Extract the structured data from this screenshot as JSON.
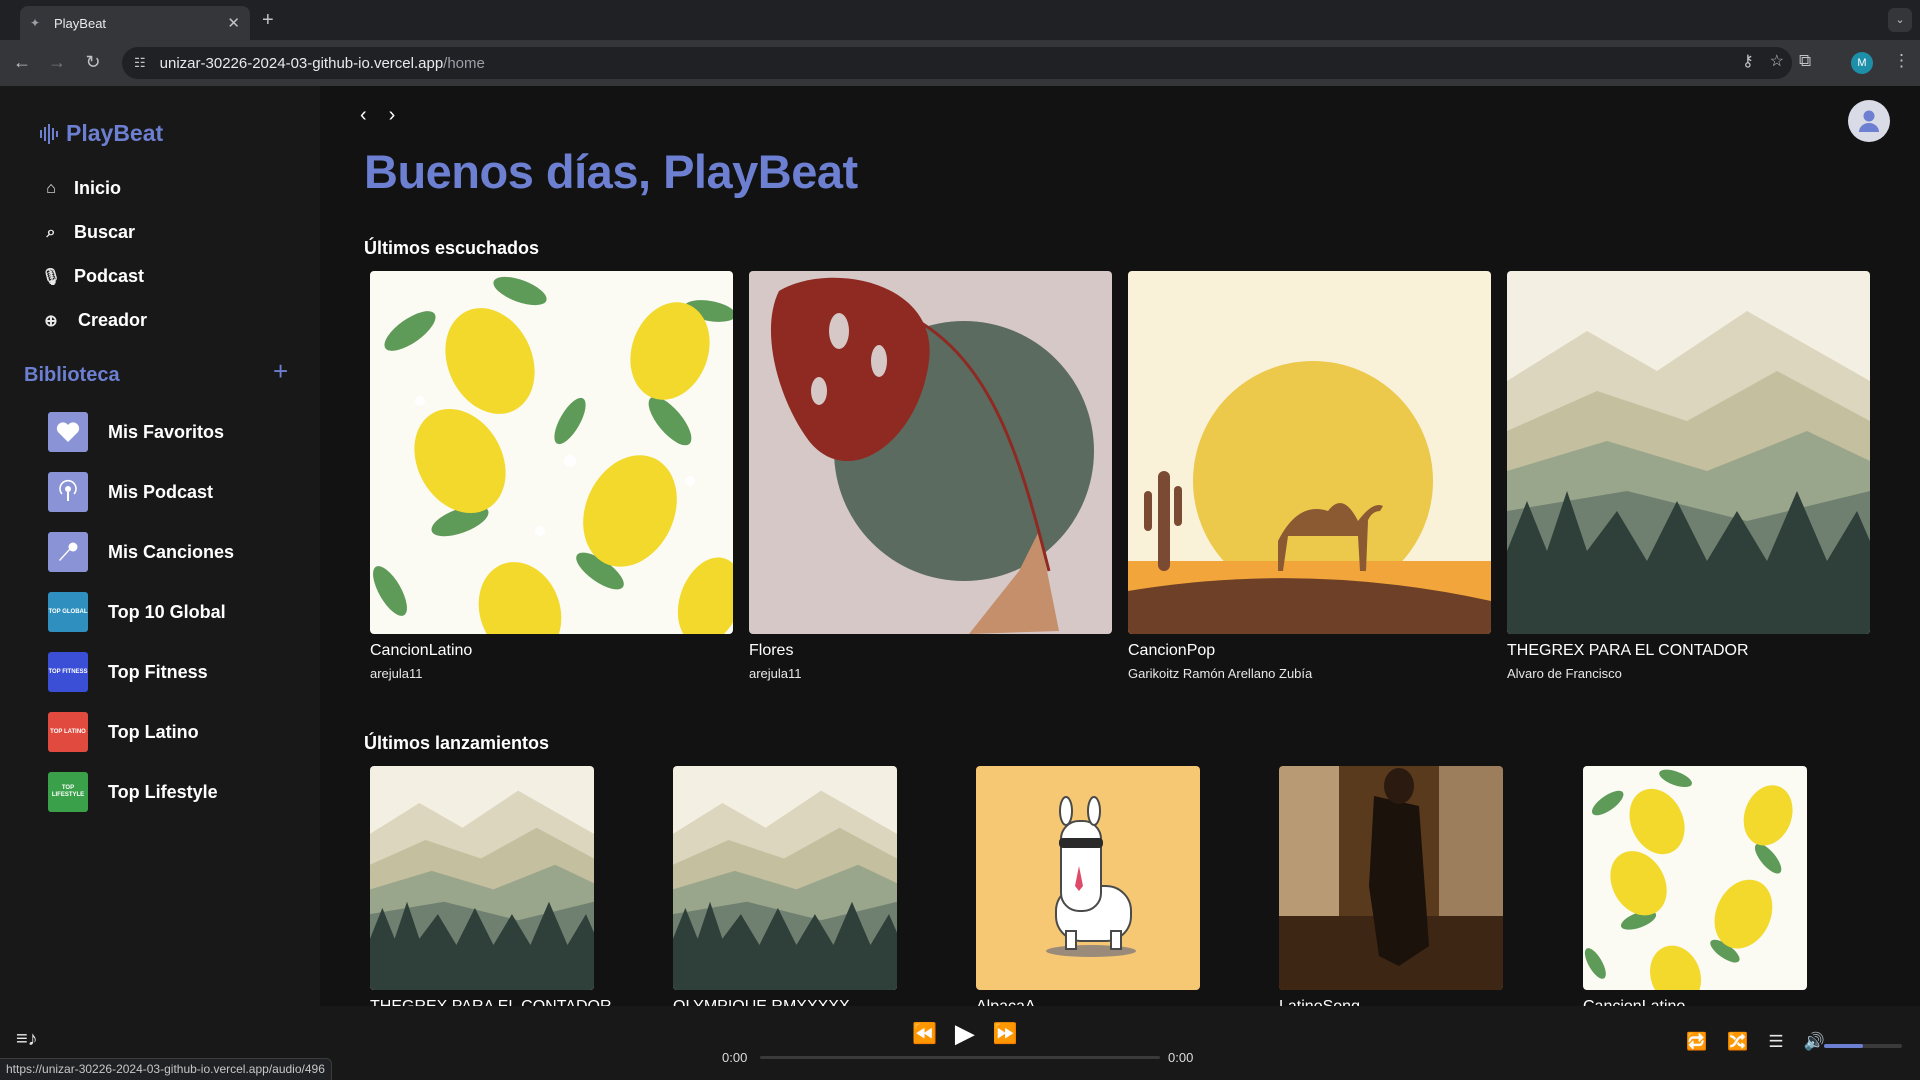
{
  "browser": {
    "tab_title": "PlayBeat",
    "url_host": "unizar-30226-2024-03-github-io.vercel.app",
    "url_path": "/home",
    "profile_initial": "M",
    "status_url": "https://unizar-30226-2024-03-github-io.vercel.app/audio/496"
  },
  "sidebar": {
    "brand": "PlayBeat",
    "nav": [
      {
        "label": "Inicio",
        "icon": "home-icon"
      },
      {
        "label": "Buscar",
        "icon": "search-icon"
      },
      {
        "label": "Podcast",
        "icon": "microphone-icon"
      },
      {
        "label": "Creador",
        "icon": "globe-icon"
      }
    ],
    "library_title": "Biblioteca",
    "library": [
      {
        "label": "Mis Favoritos",
        "color": "#8a93d6",
        "badge": ""
      },
      {
        "label": "Mis Podcast",
        "color": "#8a93d6",
        "badge": ""
      },
      {
        "label": "Mis Canciones",
        "color": "#8a93d6",
        "badge": ""
      },
      {
        "label": "Top 10 Global",
        "color": "#2f8fbf",
        "badge": "TOP GLOBAL"
      },
      {
        "label": "Top Fitness",
        "color": "#3b4fd6",
        "badge": "TOP FITNESS"
      },
      {
        "label": "Top Latino",
        "color": "#e04a3f",
        "badge": "TOP LATINO"
      },
      {
        "label": "Top Lifestyle",
        "color": "#3aa04a",
        "badge": "TOP LIFESTYLE"
      }
    ]
  },
  "main": {
    "greeting": "Buenos días, PlayBeat",
    "recent_title": "Últimos escuchados",
    "recent": [
      {
        "title": "CancionLatino",
        "artist": "arejula11",
        "art": "lemons"
      },
      {
        "title": "Flores",
        "artist": "arejula11",
        "art": "monstera"
      },
      {
        "title": "CancionPop",
        "artist": "Garikoitz Ramón Arellano Zubía",
        "art": "desert"
      },
      {
        "title": "THEGREX PARA EL CONTADOR",
        "artist": "Alvaro de Francisco",
        "art": "mountains"
      }
    ],
    "releases_title": "Últimos lanzamientos",
    "releases": [
      {
        "title": "THEGREX PARA EL CONTADOR",
        "art": "mountains"
      },
      {
        "title": "OLYMPIQUE RMXXXXX",
        "art": "mountains"
      },
      {
        "title": "AlpacaA",
        "art": "alpaca"
      },
      {
        "title": "LatinoSong",
        "art": "dance"
      },
      {
        "title": "CancionLatino",
        "art": "lemons"
      }
    ]
  },
  "player": {
    "time_current": "0:00",
    "time_total": "0:00",
    "progress": 0,
    "volume": 0.5
  }
}
